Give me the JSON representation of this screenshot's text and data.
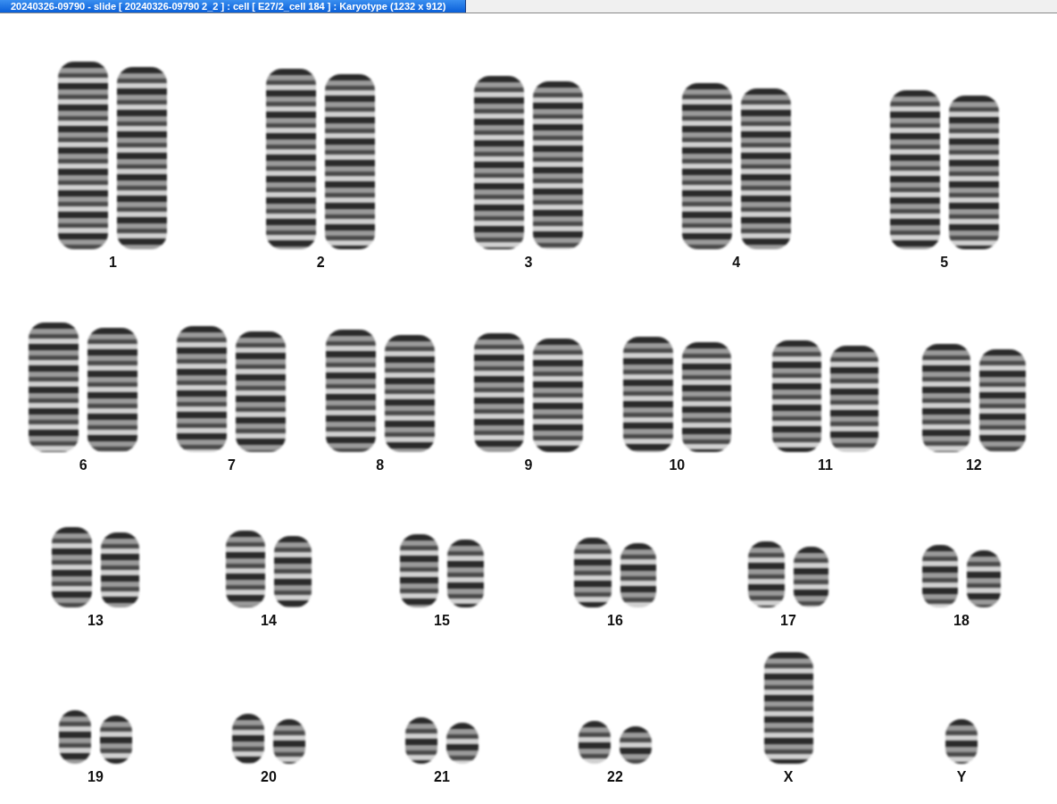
{
  "window": {
    "title": "20240326-09790 - slide [ 20240326-09790 2_2 ] : cell [ E27/2_cell 184 ] : Karyotype  (1232 x 912)"
  },
  "karyotype": {
    "rows": [
      {
        "pairs": [
          {
            "label": "1",
            "kind": "pair"
          },
          {
            "label": "2",
            "kind": "pair"
          },
          {
            "label": "3",
            "kind": "pair"
          },
          {
            "label": "4",
            "kind": "pair"
          },
          {
            "label": "5",
            "kind": "pair"
          }
        ]
      },
      {
        "pairs": [
          {
            "label": "6",
            "kind": "pair"
          },
          {
            "label": "7",
            "kind": "pair"
          },
          {
            "label": "8",
            "kind": "pair"
          },
          {
            "label": "9",
            "kind": "pair"
          },
          {
            "label": "10",
            "kind": "pair"
          },
          {
            "label": "11",
            "kind": "pair"
          },
          {
            "label": "12",
            "kind": "pair"
          }
        ]
      },
      {
        "pairs": [
          {
            "label": "13",
            "kind": "pair"
          },
          {
            "label": "14",
            "kind": "pair"
          },
          {
            "label": "15",
            "kind": "pair"
          },
          {
            "label": "16",
            "kind": "pair"
          },
          {
            "label": "17",
            "kind": "pair"
          },
          {
            "label": "18",
            "kind": "pair"
          }
        ]
      },
      {
        "pairs": [
          {
            "label": "19",
            "kind": "pair"
          },
          {
            "label": "20",
            "kind": "pair"
          },
          {
            "label": "21",
            "kind": "pair"
          },
          {
            "label": "22",
            "kind": "pair"
          },
          {
            "label": "X",
            "kind": "single"
          },
          {
            "label": "Y",
            "kind": "single"
          }
        ]
      }
    ]
  }
}
